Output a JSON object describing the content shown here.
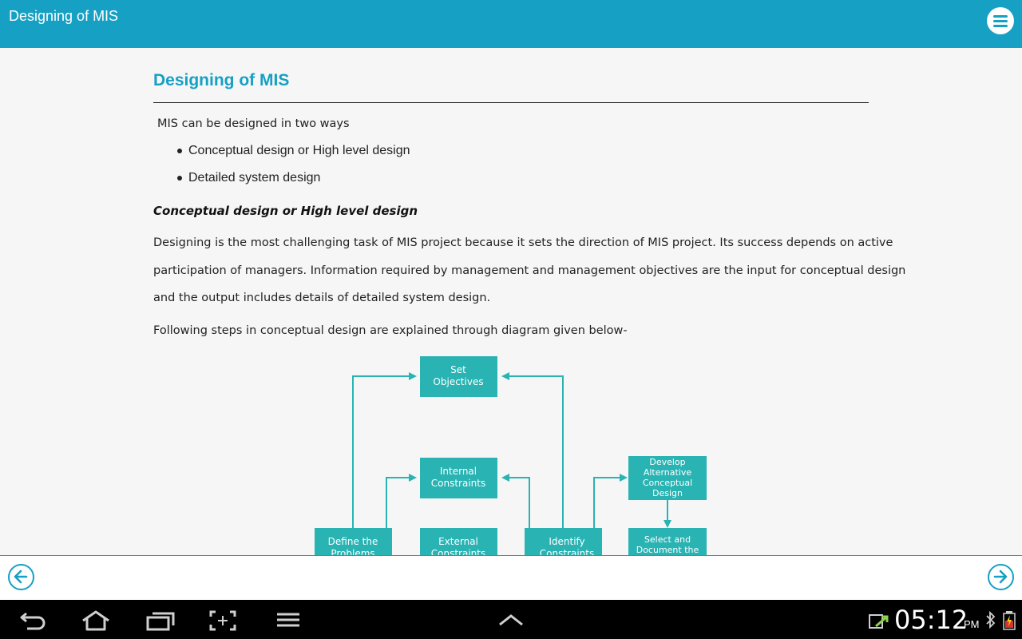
{
  "app_bar": {
    "title": "Designing of MIS",
    "menu_icon": "hamburger-circle-icon"
  },
  "article": {
    "heading": "Designing of MIS",
    "intro": "MIS can be designed in two ways",
    "bullets": [
      "Conceptual design or High level design",
      "Detailed system design"
    ],
    "subheading": "Conceptual design or High level design",
    "paragraph_lines": [
      "Designing is the most challenging task of MIS project because it sets the direction of MIS project. Its success depends on active",
      "participation of managers. Information required by management and management objectives are the input for conceptual design",
      "and the output includes details of detailed system design."
    ],
    "diagram_intro": "Following steps in conceptual design are explained through diagram given below-"
  },
  "diagram": {
    "box_color": "#2ab3b3",
    "arrow_color": "#2ab3b3",
    "set_objectives": [
      "Set",
      "Objectives"
    ],
    "internal_constraints": [
      "Internal",
      "Constraints"
    ],
    "develop_alternative": [
      "Develop",
      "Alternative",
      "Conceptual",
      "Design"
    ],
    "define_problems": [
      "Define the",
      "Problems"
    ],
    "external_constraints": [
      "External",
      "Constraints"
    ],
    "identify_constraints": [
      "Identify",
      "Constraints"
    ],
    "select_document": [
      "Select and",
      "Document the"
    ]
  },
  "footer": {
    "prev_icon": "arrow-left-circle-icon",
    "next_icon": "arrow-right-circle-icon"
  },
  "system_bar": {
    "time": "05:12",
    "ampm": "PM"
  },
  "colors": {
    "accent": "#16a0c4",
    "teal_box": "#2ab3b3"
  }
}
